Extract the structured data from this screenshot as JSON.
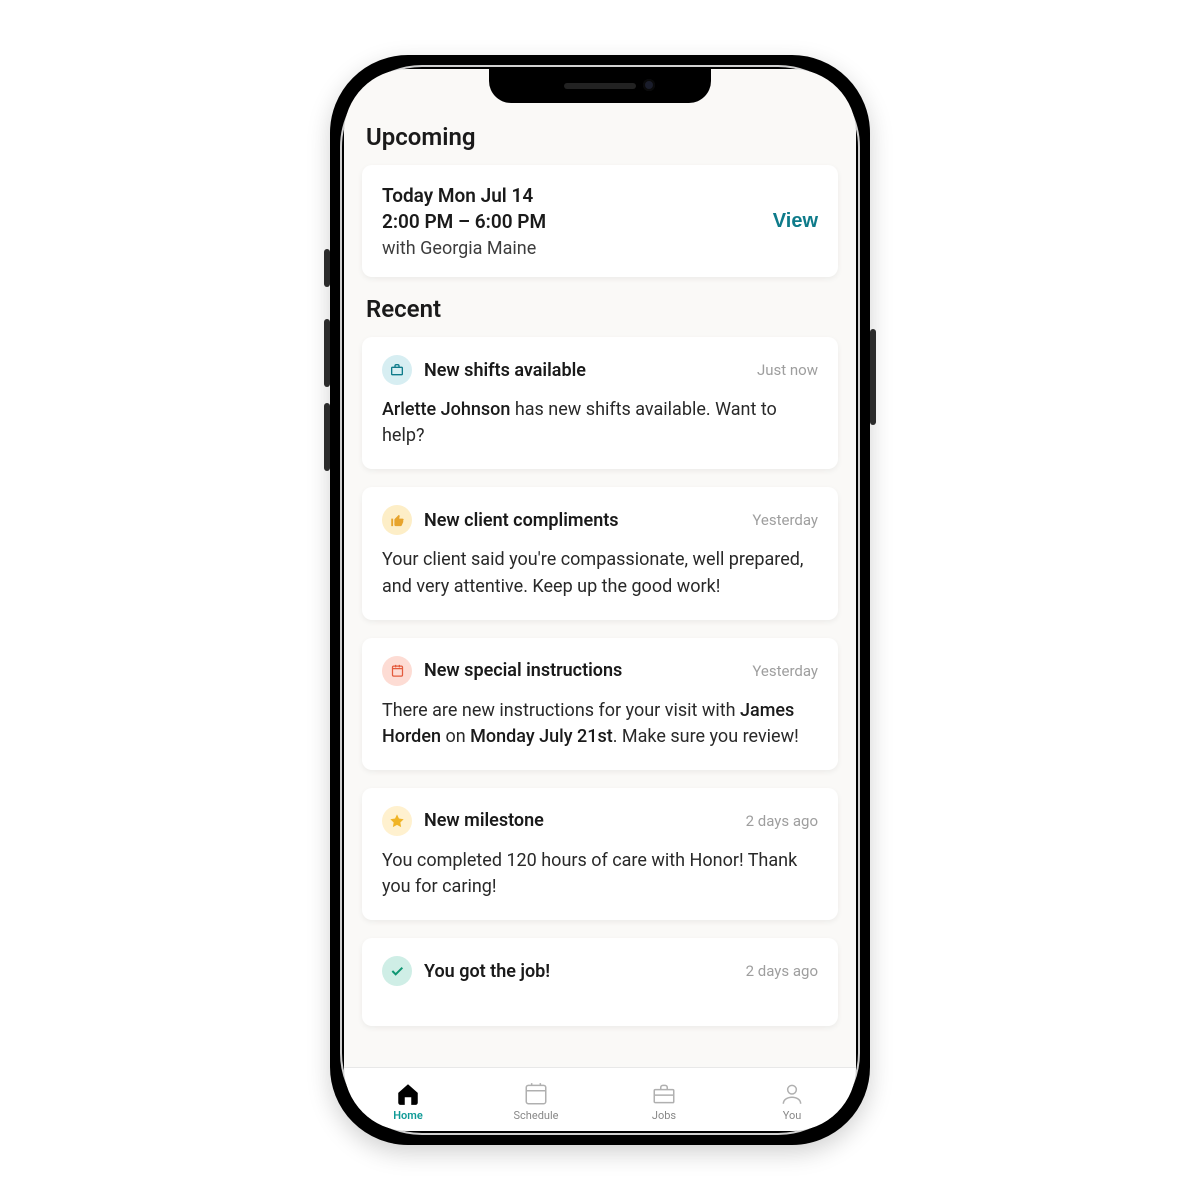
{
  "sections": {
    "upcoming_title": "Upcoming",
    "recent_title": "Recent"
  },
  "upcoming": {
    "date_line": "Today Mon Jul 14",
    "time_line": "2:00 PM – 6:00 PM",
    "with_line": "with Georgia Maine",
    "action_label": "View"
  },
  "recent": {
    "items": [
      {
        "icon": "briefcase",
        "icon_bg": "blue",
        "title": "New shifts available",
        "time": "Just now",
        "body_prefix": "",
        "body_highlight": "Arlette Johnson",
        "body_suffix": " has new shifts available. Want to help?"
      },
      {
        "icon": "thumbs-up",
        "icon_bg": "yellow",
        "title": "New client compliments",
        "time": "Yesterday",
        "body_prefix": "Your client said you're compassionate, well prepared, and very attentive. Keep up the good work!",
        "body_highlight": "",
        "body_suffix": ""
      },
      {
        "icon": "calendar",
        "icon_bg": "red",
        "title": "New special instructions",
        "time": "Yesterday",
        "body_prefix": "There are new instructions for your visit with ",
        "body_highlight": "James Horden",
        "body_mid": " on ",
        "body_highlight2": "Monday July 21st",
        "body_suffix": ". Make sure you review!"
      },
      {
        "icon": "star",
        "icon_bg": "gold",
        "title": "New milestone",
        "time": "2 days ago",
        "body_prefix": "You completed 120 hours of care with Honor! Thank you for caring!",
        "body_highlight": "",
        "body_suffix": ""
      },
      {
        "icon": "check",
        "icon_bg": "teal",
        "title": "You got the job!",
        "time": "2 days ago",
        "body_prefix": "",
        "body_highlight": "",
        "body_suffix": ""
      }
    ]
  },
  "tabs": [
    {
      "label": "Home",
      "active": true
    },
    {
      "label": "Schedule",
      "active": false
    },
    {
      "label": "Jobs",
      "active": false
    },
    {
      "label": "You",
      "active": false
    }
  ],
  "colors": {
    "accent": "#0e7b8a"
  }
}
